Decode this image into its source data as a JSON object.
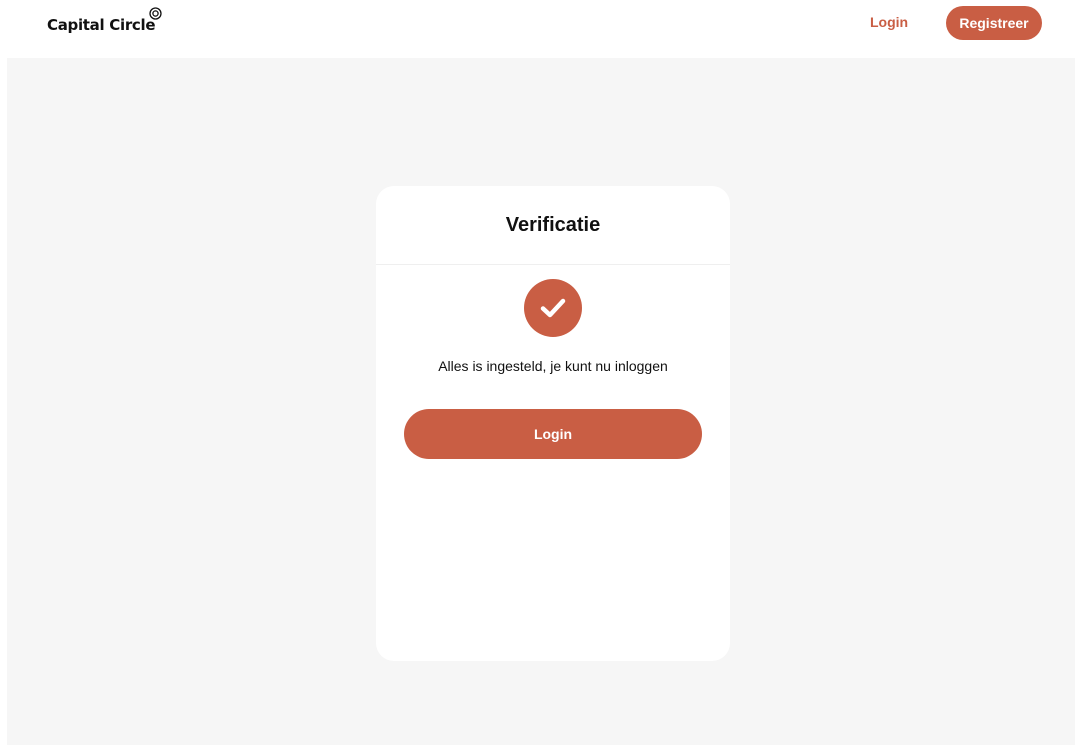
{
  "header": {
    "logo_text": "Capital Circle",
    "logo_mark": "copyright-circle-icon",
    "login_label": "Login",
    "register_label": "Registreer"
  },
  "card": {
    "title": "Verificatie",
    "status_icon": "check-icon",
    "message": "Alles is ingesteld, je kunt nu inloggen",
    "login_button_label": "Login"
  },
  "colors": {
    "accent": "#c95e44",
    "background": "#f6f6f6",
    "card": "#ffffff",
    "text": "#111111"
  }
}
